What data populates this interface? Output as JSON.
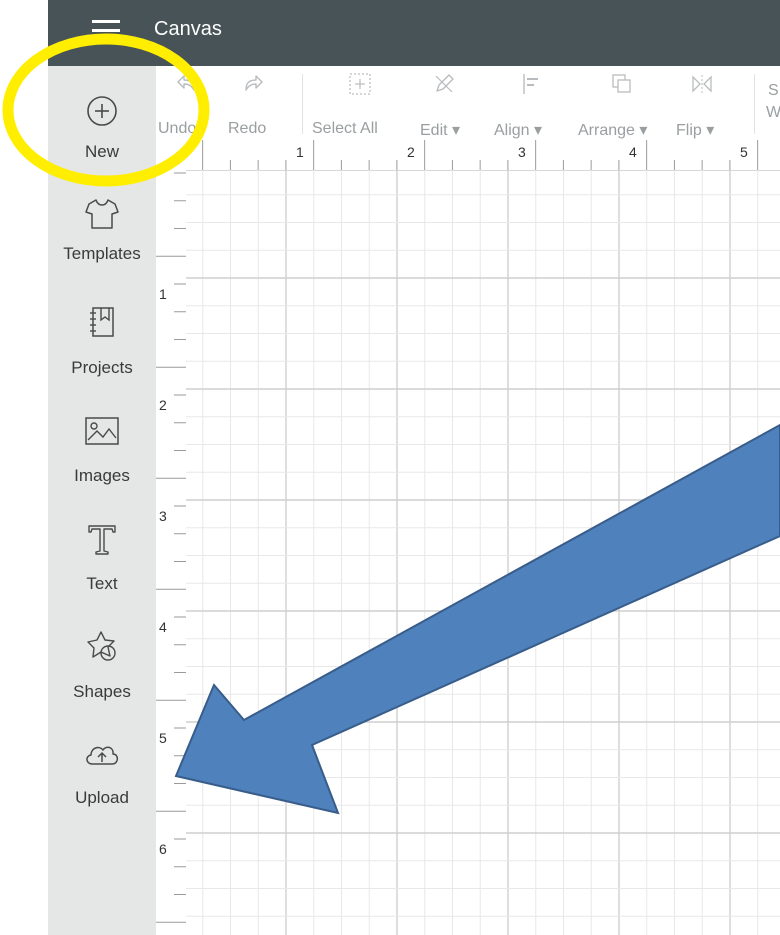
{
  "header": {
    "title": "Canvas"
  },
  "sidebar": {
    "items": [
      {
        "label": "New",
        "icon": "plus-circle-icon"
      },
      {
        "label": "Templates",
        "icon": "tshirt-icon"
      },
      {
        "label": "Projects",
        "icon": "notebook-icon"
      },
      {
        "label": "Images",
        "icon": "image-icon"
      },
      {
        "label": "Text",
        "icon": "text-t-icon"
      },
      {
        "label": "Shapes",
        "icon": "shapes-icon"
      },
      {
        "label": "Upload",
        "icon": "cloud-upload-icon"
      }
    ]
  },
  "toolbar": {
    "undo": "Undo",
    "redo": "Redo",
    "select_all": "Select All",
    "edit": "Edit",
    "align": "Align",
    "arrange": "Arrange",
    "flip": "Flip",
    "cut_s": "S",
    "cut_w": "W"
  },
  "ruler": {
    "top": [
      "1",
      "2",
      "3",
      "4",
      "5"
    ],
    "left": [
      "1",
      "2",
      "3",
      "4",
      "5",
      "6"
    ]
  },
  "colors": {
    "topbar": "#475357",
    "sidebar": "#e5e6e6",
    "highlight_circle": "#ffee00",
    "arrow_fill": "#4f81bd",
    "arrow_stroke": "#385d8a"
  }
}
